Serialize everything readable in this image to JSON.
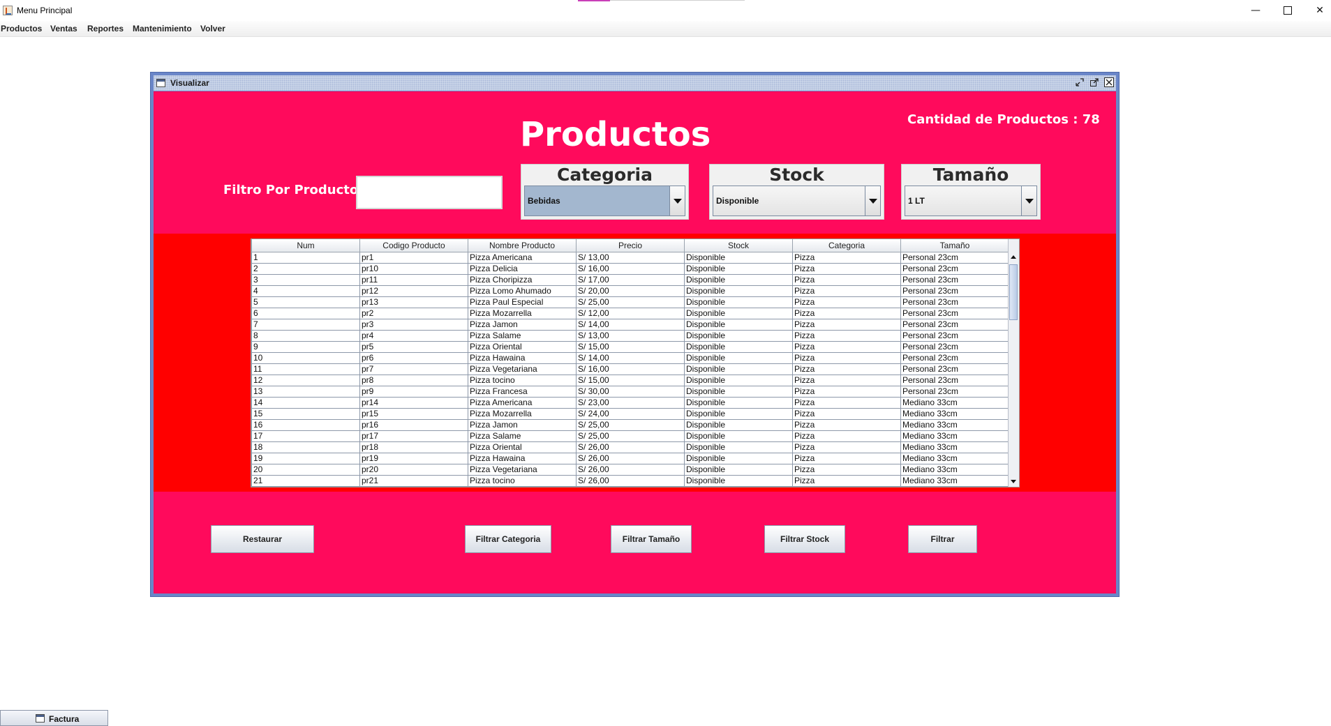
{
  "window": {
    "title": "Menu Principal",
    "controls": {
      "minimize": "—",
      "close": "✕"
    }
  },
  "menubar": {
    "items": [
      "Productos",
      "Ventas",
      "Reportes",
      "Mantenimiento",
      "Volver"
    ]
  },
  "internal_frame": {
    "title": "Visualizar",
    "heading": "Productos",
    "count_label": "Cantidad de Productos : 78",
    "filter_label": "Filtro Por Producto:",
    "filter_value": "",
    "combos": {
      "categoria": {
        "title": "Categoria",
        "value": "Bebidas"
      },
      "stock": {
        "title": "Stock",
        "value": "Disponible"
      },
      "tamano": {
        "title": "Tamaño",
        "value": "1 LT"
      }
    },
    "table": {
      "columns": [
        "Num",
        "Codigo Producto",
        "Nombre Producto",
        "Precio",
        "Stock",
        "Categoria",
        "Tamaño"
      ],
      "rows": [
        [
          "1",
          "pr1",
          "Pizza Americana",
          "S/ 13,00",
          "Disponible",
          "Pizza",
          "Personal 23cm"
        ],
        [
          "2",
          "pr10",
          "Pizza Delicia",
          "S/ 16,00",
          "Disponible",
          "Pizza",
          "Personal 23cm"
        ],
        [
          "3",
          "pr11",
          "Pizza Choripizza",
          "S/ 17,00",
          "Disponible",
          "Pizza",
          "Personal 23cm"
        ],
        [
          "4",
          "pr12",
          "Pizza Lomo Ahumado",
          "S/ 20,00",
          "Disponible",
          "Pizza",
          "Personal 23cm"
        ],
        [
          "5",
          "pr13",
          "Pizza Paul Especial",
          "S/ 25,00",
          "Disponible",
          "Pizza",
          "Personal 23cm"
        ],
        [
          "6",
          "pr2",
          "Pizza Mozarrella",
          "S/ 12,00",
          "Disponible",
          "Pizza",
          "Personal 23cm"
        ],
        [
          "7",
          "pr3",
          "Pizza Jamon",
          "S/ 14,00",
          "Disponible",
          "Pizza",
          "Personal 23cm"
        ],
        [
          "8",
          "pr4",
          "Pizza Salame",
          "S/ 13,00",
          "Disponible",
          "Pizza",
          "Personal 23cm"
        ],
        [
          "9",
          "pr5",
          "Pizza Oriental",
          "S/ 15,00",
          "Disponible",
          "Pizza",
          "Personal 23cm"
        ],
        [
          "10",
          "pr6",
          "Pizza Hawaina",
          "S/ 14,00",
          "Disponible",
          "Pizza",
          "Personal 23cm"
        ],
        [
          "11",
          "pr7",
          "Pizza Vegetariana",
          "S/ 16,00",
          "Disponible",
          "Pizza",
          "Personal 23cm"
        ],
        [
          "12",
          "pr8",
          "Pizza tocino",
          "S/ 15,00",
          "Disponible",
          "Pizza",
          "Personal 23cm"
        ],
        [
          "13",
          "pr9",
          "Pizza Francesa",
          "S/ 30,00",
          "Disponible",
          "Pizza",
          "Personal 23cm"
        ],
        [
          "14",
          "pr14",
          "Pizza Americana",
          "S/ 23,00",
          "Disponible",
          "Pizza",
          "Mediano 33cm"
        ],
        [
          "15",
          "pr15",
          "Pizza Mozarrella",
          "S/ 24,00",
          "Disponible",
          "Pizza",
          "Mediano 33cm"
        ],
        [
          "16",
          "pr16",
          "Pizza Jamon",
          "S/ 25,00",
          "Disponible",
          "Pizza",
          "Mediano 33cm"
        ],
        [
          "17",
          "pr17",
          "Pizza Salame",
          "S/ 25,00",
          "Disponible",
          "Pizza",
          "Mediano 33cm"
        ],
        [
          "18",
          "pr18",
          "Pizza Oriental",
          "S/ 26,00",
          "Disponible",
          "Pizza",
          "Mediano 33cm"
        ],
        [
          "19",
          "pr19",
          "Pizza Hawaina",
          "S/ 26,00",
          "Disponible",
          "Pizza",
          "Mediano 33cm"
        ],
        [
          "20",
          "pr20",
          "Pizza Vegetariana",
          "S/ 26,00",
          "Disponible",
          "Pizza",
          "Mediano 33cm"
        ],
        [
          "21",
          "pr21",
          "Pizza tocino",
          "S/ 26,00",
          "Disponible",
          "Pizza",
          "Mediano 33cm"
        ]
      ]
    },
    "buttons": {
      "restaurar": "Restaurar",
      "filtrar_categoria": "Filtrar Categoria",
      "filtrar_tamano": "Filtrar Tamaño",
      "filtrar_stock": "Filtrar Stock",
      "filtrar": "Filtrar"
    }
  },
  "minimized_frame": {
    "label": "Factura"
  },
  "colors": {
    "content_background": "#ff0a5c",
    "table_band": "#ff0000",
    "frame_border": "#6a86c8",
    "combo_selected": "#a3b7cf"
  },
  "icons": [
    "java-app-icon",
    "internal-frame-icon",
    "iconify-icon",
    "maximize-icon",
    "close-icon",
    "dropdown-arrow-icon",
    "scroll-up-icon",
    "scroll-down-icon"
  ]
}
